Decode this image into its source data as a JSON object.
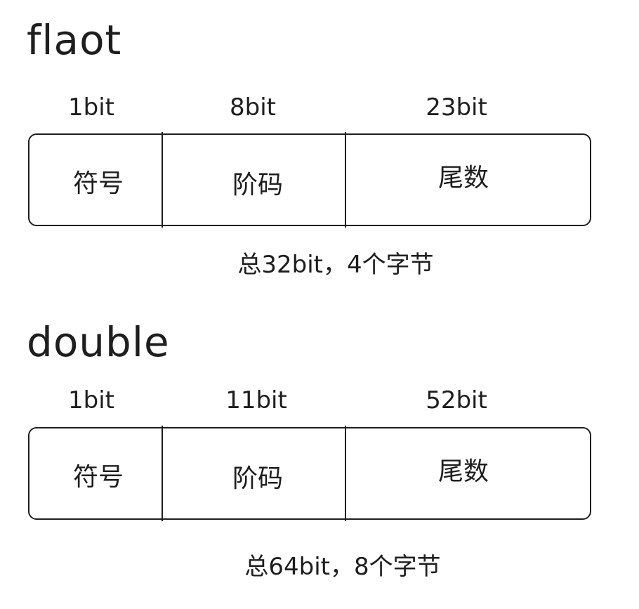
{
  "float_section": {
    "title": "flaot",
    "bits": {
      "sign": "1bit",
      "exponent": "8bit",
      "mantissa": "23bit"
    },
    "fields": {
      "sign": "符号",
      "exponent": "阶码",
      "mantissa": "尾数"
    },
    "total": "总32bit，4个字节"
  },
  "double_section": {
    "title": "double",
    "bits": {
      "sign": "1bit",
      "exponent": "11bit",
      "mantissa": "52bit"
    },
    "fields": {
      "sign": "符号",
      "exponent": "阶码",
      "mantissa": "尾数"
    },
    "total": "总64bit，8个字节"
  }
}
